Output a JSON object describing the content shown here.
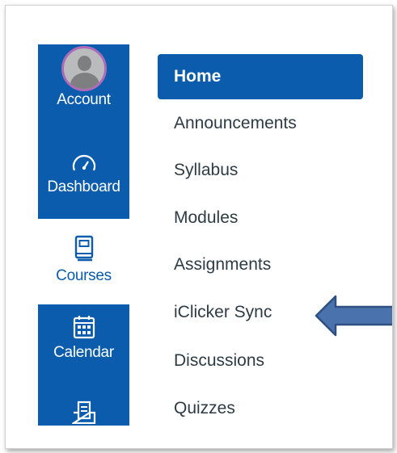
{
  "global_nav": {
    "account": {
      "label": "Account",
      "icon": "avatar"
    },
    "dashboard": {
      "label": "Dashboard",
      "icon": "gauge-icon"
    },
    "courses": {
      "label": "Courses",
      "icon": "book-icon"
    },
    "calendar": {
      "label": "Calendar",
      "icon": "calendar-icon"
    },
    "inbox": {
      "icon": "inbox-icon"
    }
  },
  "course_nav": {
    "items": [
      {
        "label": "Home",
        "active": true
      },
      {
        "label": "Announcements"
      },
      {
        "label": "Syllabus"
      },
      {
        "label": "Modules"
      },
      {
        "label": "Assignments"
      },
      {
        "label": "iClicker Sync"
      },
      {
        "label": "Discussions"
      },
      {
        "label": "Quizzes"
      }
    ]
  },
  "colors": {
    "brand": "#0b5cad",
    "text": "#2d3b45",
    "arrow": "#4a73ae"
  },
  "annotation": {
    "icon": "left-arrow-icon",
    "points_to": "iClicker Sync"
  }
}
